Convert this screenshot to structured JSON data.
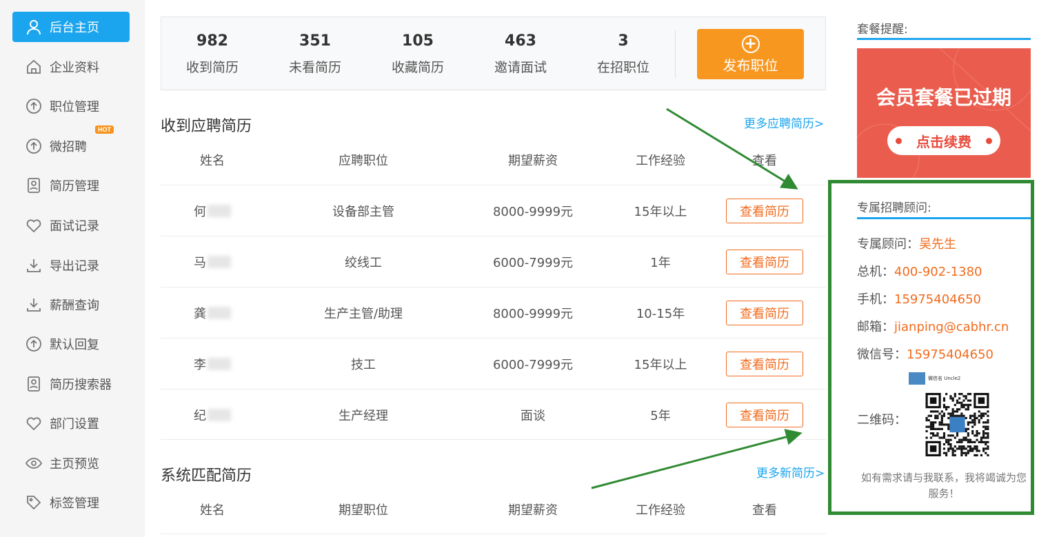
{
  "sidebar": {
    "items": [
      {
        "label": "后台主页",
        "icon": "user-icon"
      },
      {
        "label": "企业资料",
        "icon": "home-icon"
      },
      {
        "label": "职位管理",
        "icon": "upload-icon"
      },
      {
        "label": "微招聘",
        "icon": "upload-icon",
        "badge": "HOT"
      },
      {
        "label": "简历管理",
        "icon": "resume-icon"
      },
      {
        "label": "面试记录",
        "icon": "heart-icon"
      },
      {
        "label": "导出记录",
        "icon": "download-icon"
      },
      {
        "label": "薪酬查询",
        "icon": "download-icon"
      },
      {
        "label": "默认回复",
        "icon": "upload-icon"
      },
      {
        "label": "简历搜索器",
        "icon": "resume-icon"
      },
      {
        "label": "部门设置",
        "icon": "heart-icon"
      },
      {
        "label": "主页预览",
        "icon": "eye-icon"
      },
      {
        "label": "标签管理",
        "icon": "tag-icon"
      }
    ]
  },
  "stats": [
    {
      "value": "982",
      "label": "收到简历"
    },
    {
      "value": "351",
      "label": "未看简历"
    },
    {
      "value": "105",
      "label": "收藏简历"
    },
    {
      "value": "463",
      "label": "邀请面试"
    },
    {
      "value": "3",
      "label": "在招职位"
    }
  ],
  "publish_label": "发布职位",
  "received": {
    "title": "收到应聘简历",
    "more": "更多应聘简历>",
    "headers": [
      "姓名",
      "应聘职位",
      "期望薪资",
      "工作经验",
      "查看"
    ],
    "rows": [
      {
        "name": "何",
        "position": "设备部主管",
        "salary": "8000-9999元",
        "exp": "15年以上",
        "action": "查看简历"
      },
      {
        "name": "马",
        "position": "绞线工",
        "salary": "6000-7999元",
        "exp": "1年",
        "action": "查看简历"
      },
      {
        "name": "龚",
        "position": "生产主管/助理",
        "salary": "8000-9999元",
        "exp": "10-15年",
        "action": "查看简历"
      },
      {
        "name": "李",
        "position": "技工",
        "salary": "6000-7999元",
        "exp": "15年以上",
        "action": "查看简历"
      },
      {
        "name": "纪",
        "position": "生产经理",
        "salary": "面谈",
        "exp": "5年",
        "action": "查看简历"
      }
    ]
  },
  "matched": {
    "title": "系统匹配简历",
    "more": "更多新简历>",
    "headers": [
      "姓名",
      "期望职位",
      "期望薪资",
      "工作经验",
      "查看"
    ]
  },
  "package": {
    "title": "套餐提醒:",
    "banner_text": "会员套餐已过期",
    "renew_label": "点击续费"
  },
  "consultant": {
    "title": "专属招聘顾问:",
    "advisor_label": "专属顾问：",
    "advisor": "吴先生",
    "phone_label": "总机：",
    "phone": "400-902-1380",
    "mobile_label": "手机：",
    "mobile": "15975404650",
    "email_label": "邮箱：",
    "email": "jianping@cabhr.cn",
    "wechat_label": "微信号：",
    "wechat": "15975404650",
    "qr_label": "二维码：",
    "qr_name": "微信名 Uncle2",
    "note": "如有需求请与我联系，我将竭诚为您服务！"
  },
  "colors": {
    "accent": "#1ba5ee",
    "orange": "#f26b1d",
    "publish": "#f89720",
    "highlight": "#2f8a32"
  }
}
